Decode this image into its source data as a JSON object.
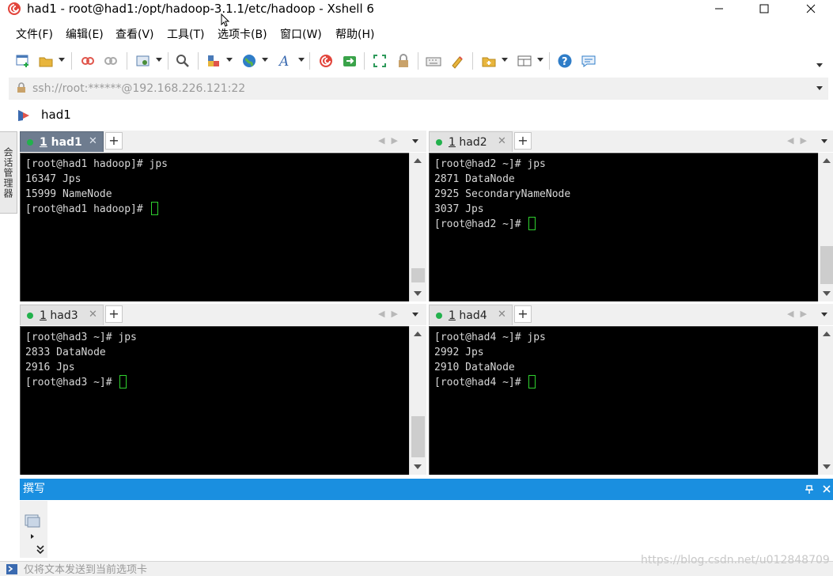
{
  "window": {
    "title": "had1 - root@had1:/opt/hadoop-3.1.1/etc/hadoop - Xshell 6",
    "minimize_glyph": "─",
    "maximize_glyph": "☐",
    "close_glyph": "✕"
  },
  "menu": {
    "items": [
      {
        "label": "文件(F)"
      },
      {
        "label": "编辑(E)"
      },
      {
        "label": "查看(V)"
      },
      {
        "label": "工具(T)"
      },
      {
        "label": "选项卡(B)"
      },
      {
        "label": "窗口(W)"
      },
      {
        "label": "帮助(H)"
      }
    ]
  },
  "toolbar": {
    "icons": [
      "new-session-icon",
      "open-folder-icon",
      "reconnect-icon",
      "disconnect-icon",
      "properties-icon",
      "find-icon",
      "transfer-icon",
      "globe-icon",
      "font-icon",
      "xshell-icon",
      "xftp-icon",
      "fullscreen-icon",
      "lock-icon",
      "keyboard-icon",
      "highlight-icon",
      "new-tab-icon",
      "layout-icon",
      "help-icon",
      "chat-icon"
    ]
  },
  "address": {
    "text": "ssh://root:******@192.168.226.121:22",
    "icon": "lock-icon"
  },
  "session": {
    "label": "had1",
    "icon": "session-flag-icon"
  },
  "side_tab": {
    "label": "会话管理器"
  },
  "panes": [
    {
      "tab_label_num": "1",
      "tab_label_name": "had1",
      "active": true,
      "lines": [
        "[root@had1 hadoop]# jps",
        "16347 Jps",
        "15999 NameNode"
      ],
      "prompt": "[root@had1 hadoop]# "
    },
    {
      "tab_label_num": "1",
      "tab_label_name": "had2",
      "active": false,
      "lines": [
        "[root@had2 ~]# jps",
        "2871 DataNode",
        "2925 SecondaryNameNode",
        "3037 Jps"
      ],
      "prompt": "[root@had2 ~]# "
    },
    {
      "tab_label_num": "1",
      "tab_label_name": "had3",
      "active": false,
      "lines": [
        "[root@had3 ~]# jps",
        "2833 DataNode",
        "2916 Jps"
      ],
      "prompt": "[root@had3 ~]# "
    },
    {
      "tab_label_num": "1",
      "tab_label_name": "had4",
      "active": false,
      "lines": [
        "[root@had4 ~]# jps",
        "2992 Jps",
        "2910 DataNode"
      ],
      "prompt": "[root@had4 ~]# "
    }
  ],
  "tab_close_glyph": "✕",
  "tab_add_glyph": "+",
  "compose": {
    "title": "撰写",
    "pin_glyph": "ᛘ",
    "close_glyph": "✕",
    "send_placeholder": "仅将文本发送到当前选项卡"
  },
  "watermark": "https://blog.csdn.net/u012848709",
  "colors": {
    "compose_header": "#1a8fe0",
    "active_tab": "#6e7c8f",
    "terminal_bg": "#000000",
    "cursor": "#2fd12f",
    "status_dot": "#22b14c"
  }
}
